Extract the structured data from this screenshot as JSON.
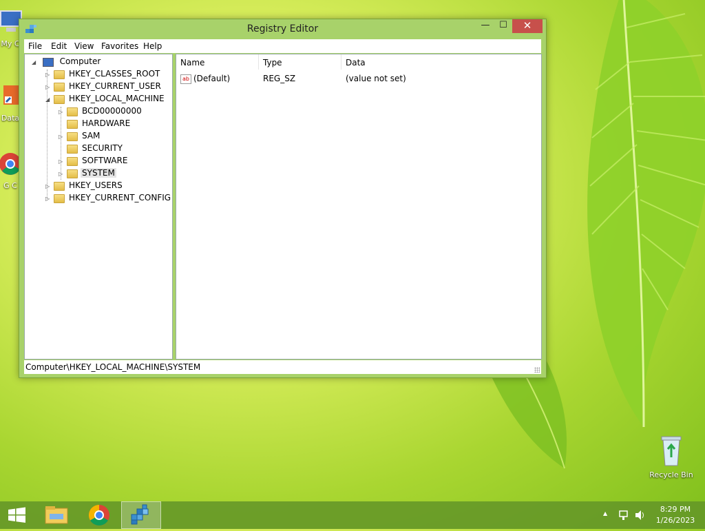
{
  "desktop": {
    "icons": [
      {
        "label": "My C",
        "icon": "computer-icon"
      },
      {
        "label": "Data",
        "icon": "shortcut-icon"
      },
      {
        "label": "G C",
        "icon": "chrome-icon"
      },
      {
        "label": "Recycle Bin",
        "icon": "recycle-bin-icon"
      }
    ]
  },
  "window": {
    "title": "Registry Editor",
    "controls": {
      "minimize": "—",
      "maximize": "☐",
      "close": "✕"
    },
    "menu": [
      "File",
      "Edit",
      "View",
      "Favorites",
      "Help"
    ],
    "tree": {
      "root": "Computer",
      "nodes": [
        {
          "label": "HKEY_CLASSES_ROOT",
          "expander": "▷"
        },
        {
          "label": "HKEY_CURRENT_USER",
          "expander": "▷"
        },
        {
          "label": "HKEY_LOCAL_MACHINE",
          "expander": "◢"
        },
        {
          "label": "BCD00000000",
          "expander": "▷"
        },
        {
          "label": "HARDWARE",
          "expander": ""
        },
        {
          "label": "SAM",
          "expander": "▷"
        },
        {
          "label": "SECURITY",
          "expander": ""
        },
        {
          "label": "SOFTWARE",
          "expander": "▷"
        },
        {
          "label": "SYSTEM",
          "expander": "▷"
        },
        {
          "label": "HKEY_USERS",
          "expander": "▷"
        },
        {
          "label": "HKEY_CURRENT_CONFIG",
          "expander": "▷"
        }
      ]
    },
    "list": {
      "columns": [
        "Name",
        "Type",
        "Data"
      ],
      "rows": [
        {
          "name": "(Default)",
          "type": "REG_SZ",
          "data": "(value not set)",
          "icon_text": "ab"
        }
      ]
    },
    "status": "Computer\\HKEY_LOCAL_MACHINE\\SYSTEM"
  },
  "taskbar": {
    "clock_time": "8:29 PM",
    "clock_date": "1/26/2023",
    "tray_up_arrow": "▲",
    "items": [
      "start-icon",
      "file-explorer-icon",
      "chrome-icon",
      "registry-editor-icon"
    ]
  },
  "colors": {
    "close_button": "#c7504b",
    "window_frame": "#a8d26a",
    "taskbar": "#64962a"
  }
}
